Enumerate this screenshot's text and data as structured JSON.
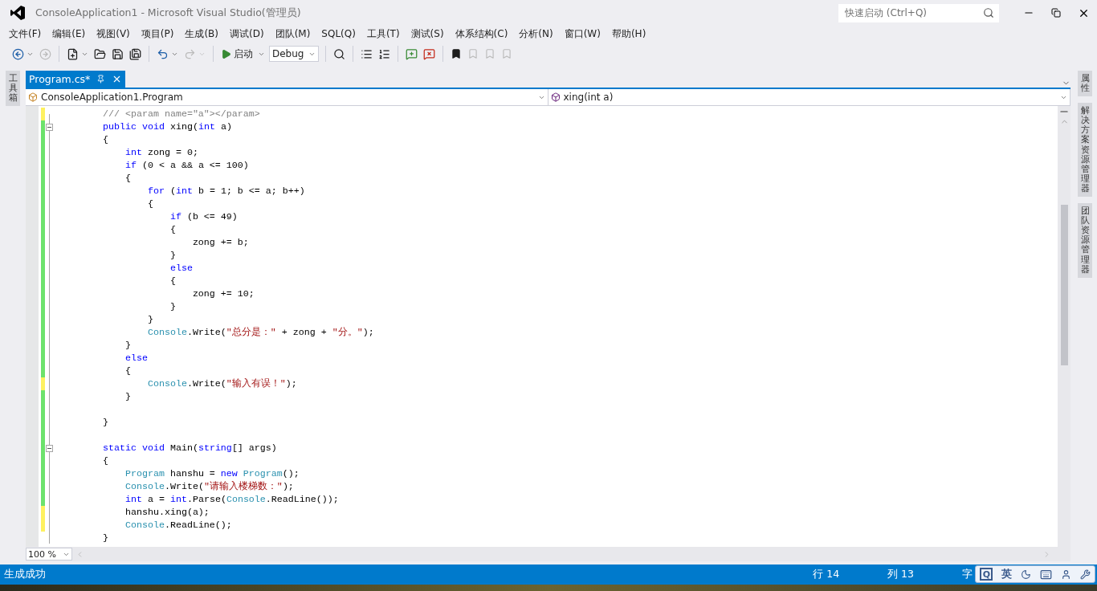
{
  "window": {
    "title": "ConsoleApplication1 - Microsoft Visual Studio(管理员)"
  },
  "quick_launch": {
    "placeholder": "快速启动 (Ctrl+Q)"
  },
  "menu": [
    "文件(F)",
    "编辑(E)",
    "视图(V)",
    "项目(P)",
    "生成(B)",
    "调试(D)",
    "团队(M)",
    "SQL(Q)",
    "工具(T)",
    "测试(S)",
    "体系结构(C)",
    "分析(N)",
    "窗口(W)",
    "帮助(H)"
  ],
  "toolbar": {
    "run_label": "启动",
    "configuration": "Debug"
  },
  "left_panel_tabs": [
    "工具箱"
  ],
  "tabs": [
    {
      "label": "Program.cs*",
      "selected": true
    }
  ],
  "nav": {
    "type": "ConsoleApplication1.Program",
    "member": "xing(int a)"
  },
  "code_lines": [
    {
      "changed": true,
      "saved": false,
      "foldable": false,
      "segments": [
        {
          "kind": "comment",
          "text": "        /// <param name=\"a\"></param>"
        }
      ]
    },
    {
      "changed": true,
      "saved": true,
      "foldable": true,
      "segments": [
        {
          "kind": "keyword",
          "text": "        public void"
        },
        {
          "kind": "plain",
          "text": " xing("
        },
        {
          "kind": "keyword",
          "text": "int"
        },
        {
          "kind": "plain",
          "text": " a)"
        }
      ]
    },
    {
      "changed": true,
      "saved": true,
      "foldable": false,
      "segments": [
        {
          "kind": "plain",
          "text": "        {"
        }
      ]
    },
    {
      "changed": true,
      "saved": true,
      "foldable": false,
      "segments": [
        {
          "kind": "keyword",
          "text": "            int"
        },
        {
          "kind": "plain",
          "text": " zong = 0;"
        }
      ]
    },
    {
      "changed": true,
      "saved": true,
      "foldable": false,
      "segments": [
        {
          "kind": "keyword",
          "text": "            if"
        },
        {
          "kind": "plain",
          "text": " (0 < a && a <= 100)"
        }
      ]
    },
    {
      "changed": true,
      "saved": true,
      "foldable": false,
      "segments": [
        {
          "kind": "plain",
          "text": "            {"
        }
      ]
    },
    {
      "changed": true,
      "saved": true,
      "foldable": false,
      "segments": [
        {
          "kind": "keyword",
          "text": "                for"
        },
        {
          "kind": "plain",
          "text": " ("
        },
        {
          "kind": "keyword",
          "text": "int"
        },
        {
          "kind": "plain",
          "text": " b = 1; b <= a; b++)"
        }
      ]
    },
    {
      "changed": true,
      "saved": true,
      "foldable": false,
      "segments": [
        {
          "kind": "plain",
          "text": "                {"
        }
      ]
    },
    {
      "changed": true,
      "saved": true,
      "foldable": false,
      "segments": [
        {
          "kind": "keyword",
          "text": "                    if"
        },
        {
          "kind": "plain",
          "text": " (b <= 49)"
        }
      ]
    },
    {
      "changed": true,
      "saved": true,
      "foldable": false,
      "segments": [
        {
          "kind": "plain",
          "text": "                    {"
        }
      ]
    },
    {
      "changed": true,
      "saved": true,
      "foldable": false,
      "segments": [
        {
          "kind": "plain",
          "text": "                        zong += b;"
        }
      ]
    },
    {
      "changed": true,
      "saved": true,
      "foldable": false,
      "segments": [
        {
          "kind": "plain",
          "text": "                    }"
        }
      ]
    },
    {
      "changed": true,
      "saved": true,
      "foldable": false,
      "segments": [
        {
          "kind": "keyword",
          "text": "                    else"
        }
      ]
    },
    {
      "changed": true,
      "saved": true,
      "foldable": false,
      "segments": [
        {
          "kind": "plain",
          "text": "                    {"
        }
      ]
    },
    {
      "changed": true,
      "saved": true,
      "foldable": false,
      "segments": [
        {
          "kind": "plain",
          "text": "                        zong += 10;"
        }
      ]
    },
    {
      "changed": true,
      "saved": true,
      "foldable": false,
      "segments": [
        {
          "kind": "plain",
          "text": "                    }"
        }
      ]
    },
    {
      "changed": true,
      "saved": true,
      "foldable": false,
      "segments": [
        {
          "kind": "plain",
          "text": "                }"
        }
      ]
    },
    {
      "changed": true,
      "saved": true,
      "foldable": false,
      "segments": [
        {
          "kind": "type",
          "text": "                Console"
        },
        {
          "kind": "plain",
          "text": ".Write("
        },
        {
          "kind": "string",
          "text": "\"总分是：\""
        },
        {
          "kind": "plain",
          "text": " + zong + "
        },
        {
          "kind": "string",
          "text": "\"分。\""
        },
        {
          "kind": "plain",
          "text": ");"
        }
      ]
    },
    {
      "changed": true,
      "saved": true,
      "foldable": false,
      "segments": [
        {
          "kind": "plain",
          "text": "            }"
        }
      ]
    },
    {
      "changed": true,
      "saved": true,
      "foldable": false,
      "segments": [
        {
          "kind": "keyword",
          "text": "            else"
        }
      ]
    },
    {
      "changed": true,
      "saved": true,
      "foldable": false,
      "segments": [
        {
          "kind": "plain",
          "text": "            {"
        }
      ]
    },
    {
      "changed": true,
      "saved": false,
      "foldable": false,
      "segments": [
        {
          "kind": "type",
          "text": "                Console"
        },
        {
          "kind": "plain",
          "text": ".Write("
        },
        {
          "kind": "string",
          "text": "\"输入有误！\""
        },
        {
          "kind": "plain",
          "text": ");"
        }
      ]
    },
    {
      "changed": true,
      "saved": true,
      "foldable": false,
      "segments": [
        {
          "kind": "plain",
          "text": "            }"
        }
      ]
    },
    {
      "changed": true,
      "saved": true
    },
    {
      "changed": true,
      "saved": true,
      "foldable": false,
      "segments": [
        {
          "kind": "plain",
          "text": "        }"
        }
      ]
    },
    {
      "changed": true,
      "saved": true
    },
    {
      "changed": true,
      "saved": true,
      "foldable": true,
      "segments": [
        {
          "kind": "keyword",
          "text": "        static void"
        },
        {
          "kind": "plain",
          "text": " Main("
        },
        {
          "kind": "keyword",
          "text": "string"
        },
        {
          "kind": "plain",
          "text": "[] args)"
        }
      ]
    },
    {
      "changed": true,
      "saved": true,
      "foldable": false,
      "segments": [
        {
          "kind": "plain",
          "text": "        {"
        }
      ]
    },
    {
      "changed": true,
      "saved": true,
      "foldable": false,
      "segments": [
        {
          "kind": "type",
          "text": "            Program"
        },
        {
          "kind": "plain",
          "text": " hanshu = "
        },
        {
          "kind": "keyword",
          "text": "new"
        },
        {
          "kind": "type",
          "text": " Program"
        },
        {
          "kind": "plain",
          "text": "();"
        }
      ]
    },
    {
      "changed": true,
      "saved": true,
      "foldable": false,
      "segments": [
        {
          "kind": "type",
          "text": "            Console"
        },
        {
          "kind": "plain",
          "text": ".Write("
        },
        {
          "kind": "string",
          "text": "\"请输入楼梯数：\""
        },
        {
          "kind": "plain",
          "text": ");"
        }
      ]
    },
    {
      "changed": true,
      "saved": true,
      "foldable": false,
      "segments": [
        {
          "kind": "keyword",
          "text": "            int"
        },
        {
          "kind": "plain",
          "text": " a = "
        },
        {
          "kind": "keyword",
          "text": "int"
        },
        {
          "kind": "plain",
          "text": ".Parse("
        },
        {
          "kind": "type",
          "text": "Console"
        },
        {
          "kind": "plain",
          "text": ".ReadLine());"
        }
      ]
    },
    {
      "changed": true,
      "saved": false,
      "foldable": false,
      "segments": [
        {
          "kind": "plain",
          "text": "            hanshu.xing(a);"
        }
      ]
    },
    {
      "changed": true,
      "saved": false,
      "foldable": false,
      "segments": [
        {
          "kind": "type",
          "text": "            Console"
        },
        {
          "kind": "plain",
          "text": ".ReadLine();"
        }
      ]
    },
    {
      "changed": false,
      "foldable": false,
      "segments": [
        {
          "kind": "plain",
          "text": "        }"
        }
      ]
    }
  ],
  "zoom": "100 %",
  "status": {
    "message": "生成成功",
    "line": "行 14",
    "column": "列 13",
    "char": "字"
  },
  "ime": {
    "logo": "Q",
    "mode": "英"
  },
  "right_panel_tabs": [
    "属性",
    "解决方案资源管理器",
    "团队资源管理器"
  ]
}
